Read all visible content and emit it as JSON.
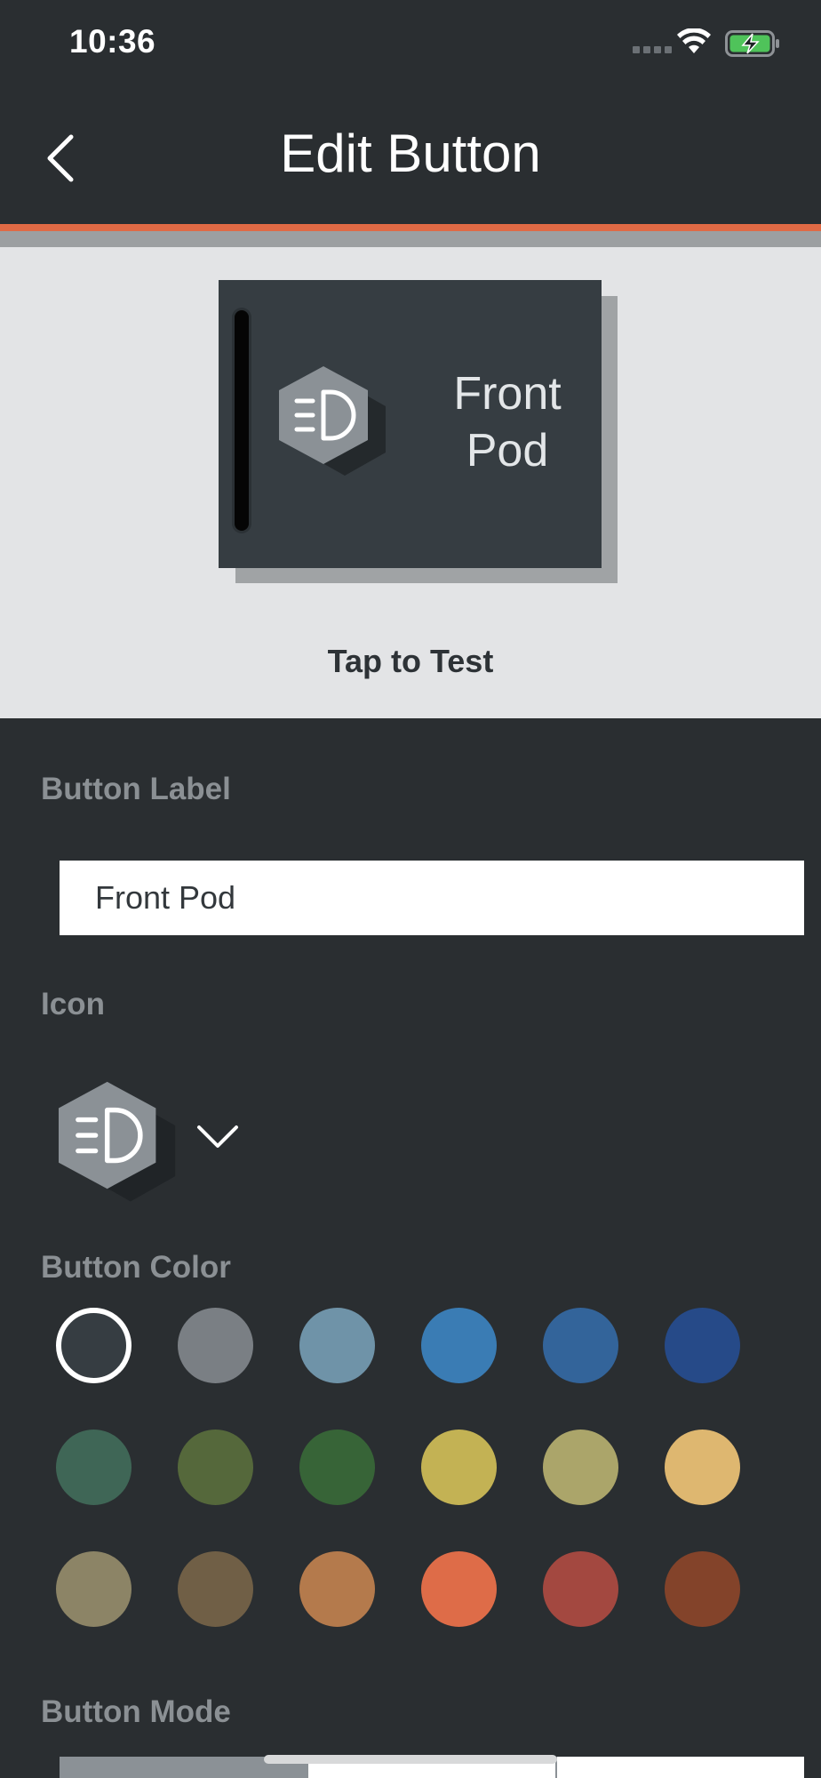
{
  "status_bar": {
    "time": "10:36"
  },
  "header": {
    "title": "Edit Button"
  },
  "preview": {
    "label_line1": "Front",
    "label_line2": "Pod",
    "tap_text": "Tap to Test",
    "icon": "headlight-icon"
  },
  "form": {
    "label_section": "Button Label",
    "label_value": "Front Pod",
    "icon_section": "Icon",
    "icon_value": "headlight-icon",
    "color_section": "Button Color",
    "mode_section": "Button Mode"
  },
  "colors": [
    "#363d42",
    "#7a7f84",
    "#6f93a8",
    "#3a7cb4",
    "#33649a",
    "#264a88",
    "#3f6656",
    "#55683b",
    "#376437",
    "#c3b254",
    "#aba56a",
    "#deb770",
    "#8c8466",
    "#705f46",
    "#b47a4c",
    "#de6c48",
    "#a34840",
    "#83432a"
  ],
  "selected_color_index": 0,
  "mode_segments_active": 0
}
